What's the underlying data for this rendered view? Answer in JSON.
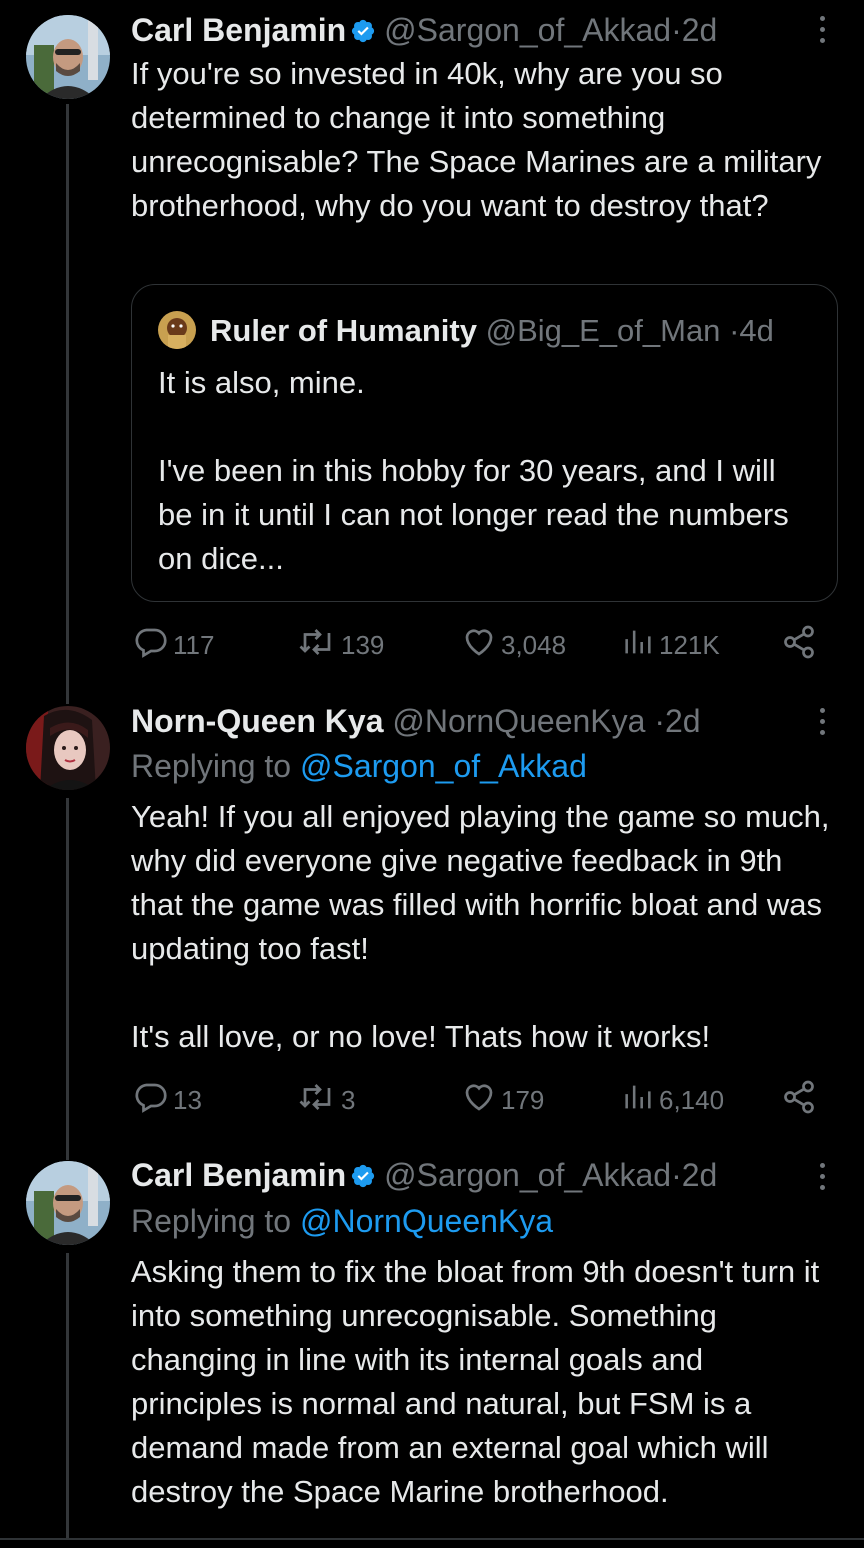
{
  "tweets": [
    {
      "name": "Carl Benjamin",
      "handle": "@Sargon_of_Akkad",
      "dot": "·",
      "time": "2d",
      "verified": true,
      "text": "If you're so invested in 40k, why are you so determined to change it into something unrecognisable? The Space Marines are a military brotherhood, why do you want to destroy that?",
      "quote": {
        "name": "Ruler of Humanity",
        "handle": "@Big_E_of_Man",
        "dot": "·",
        "time": "4d",
        "text": "It is also, mine.\n\nI've been in this hobby for 30 years, and I will be in it until I can not longer read the numbers on dice..."
      },
      "stats": {
        "replies": "117",
        "retweets": "139",
        "likes": "3,048",
        "views": "121K"
      }
    },
    {
      "name": "Norn-Queen Kya",
      "handle": "@NornQueenKya",
      "dot": "·",
      "time": "2d",
      "replying_label": "Replying to ",
      "replying_to": "@Sargon_of_Akkad",
      "text": "Yeah! If you all enjoyed playing the game so much, why did everyone give negative feedback in 9th that the game was filled with horrific bloat and was updating too fast!\n\nIt's all love, or no love! Thats how it works!",
      "stats": {
        "replies": "13",
        "retweets": "3",
        "likes": "179",
        "views": "6,140"
      }
    },
    {
      "name": "Carl Benjamin",
      "handle": "@Sargon_of_Akkad",
      "dot": "·",
      "time": "2d",
      "verified": true,
      "replying_label": "Replying to ",
      "replying_to": "@NornQueenKya",
      "text": "Asking them to fix the bloat from 9th doesn't turn it into something unrecognisable. Something changing in line with its internal goals and principles is normal and natural, but FSM is a demand made from an external goal which will destroy the Space Marine brotherhood."
    }
  ],
  "icons": {
    "reply": "reply-icon",
    "retweet": "retweet-icon",
    "like": "heart-icon",
    "views": "views-icon",
    "share": "share-icon",
    "more": "more-icon",
    "verified": "verified-badge-icon"
  },
  "colors": {
    "background": "#000000",
    "text": "#e7e9ea",
    "muted": "#71767b",
    "link": "#1d9bf0",
    "verified": "#1d9bf0"
  }
}
